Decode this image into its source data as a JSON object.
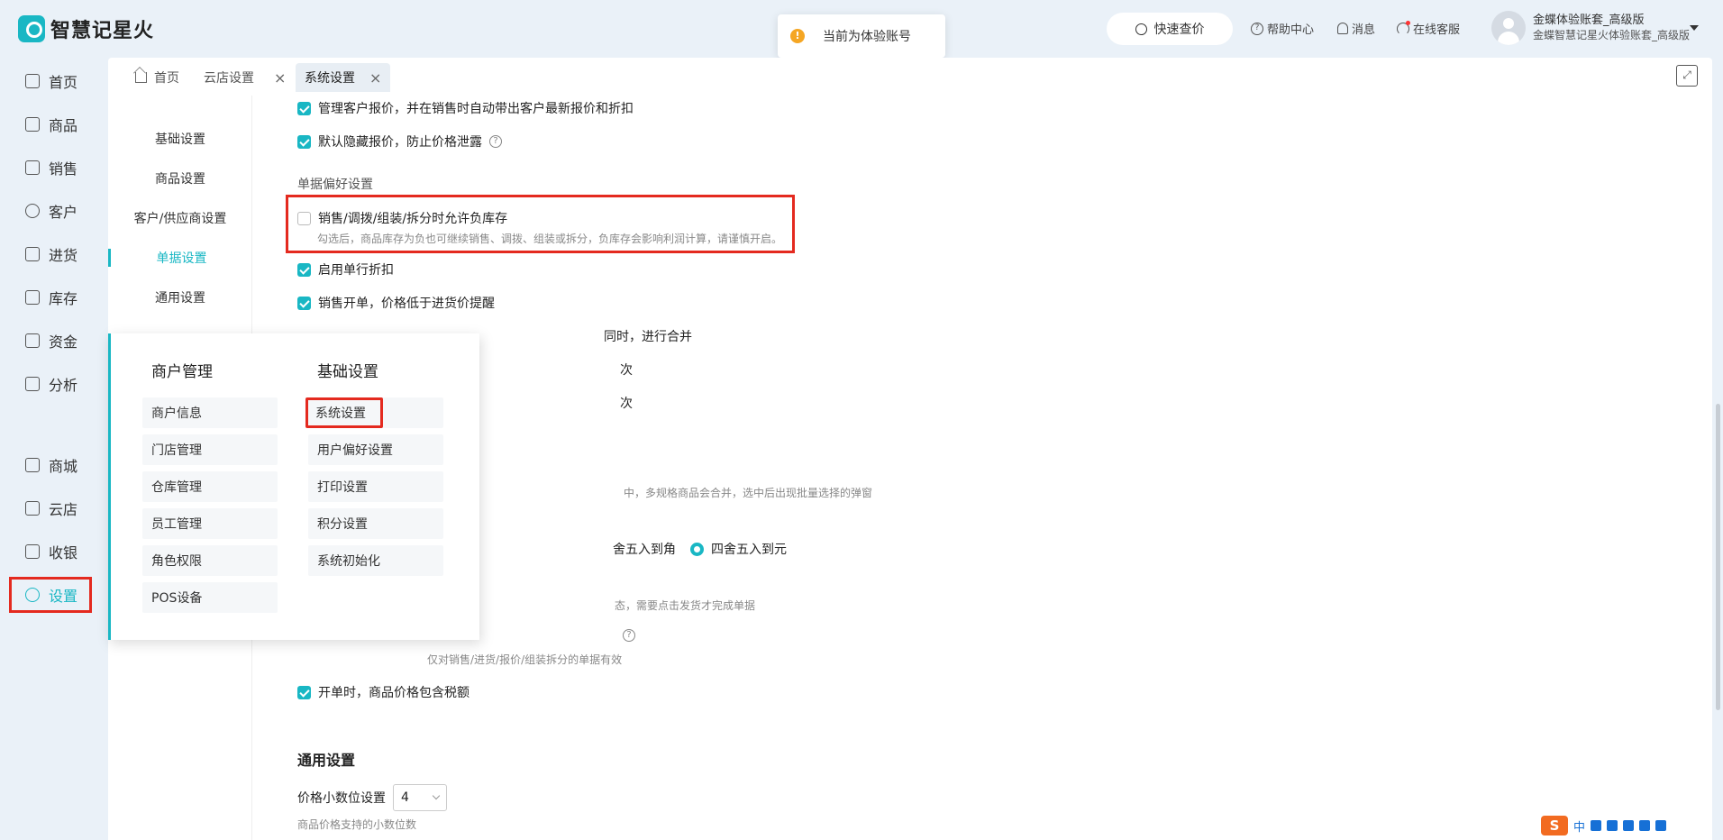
{
  "app": {
    "logo_text": "智慧记星火"
  },
  "toast": {
    "text": "当前为体验账号"
  },
  "topbar": {
    "quick_price": "快速查价",
    "help": "帮助中心",
    "messages": "消息",
    "online_service": "在线客服",
    "user_name": "金蝶体验账套_高级版",
    "user_sub": "金蝶智慧记星火体验账套_高级版"
  },
  "sidebar": {
    "items": [
      {
        "label": "首页"
      },
      {
        "label": "商品"
      },
      {
        "label": "销售"
      },
      {
        "label": "客户"
      },
      {
        "label": "进货"
      },
      {
        "label": "库存"
      },
      {
        "label": "资金"
      },
      {
        "label": "分析"
      },
      {
        "label": "商城"
      },
      {
        "label": "云店"
      },
      {
        "label": "收银"
      },
      {
        "label": "设置"
      }
    ]
  },
  "tabs": [
    {
      "label": "首页"
    },
    {
      "label": "云店设置"
    },
    {
      "label": "系统设置"
    }
  ],
  "subnav": {
    "items": [
      {
        "label": "基础设置"
      },
      {
        "label": "商品设置"
      },
      {
        "label": "客户/供应商设置"
      },
      {
        "label": "单据设置"
      },
      {
        "label": "通用设置"
      }
    ]
  },
  "content": {
    "opt_manage_price": "管理客户报价，并在销售时自动带出客户最新报价和折扣",
    "opt_hide_price": "默认隐藏报价，防止价格泄露",
    "doc_pref_label": "单据偏好设置",
    "opt_negative_stock": "销售/调拨/组装/拆分时允许负库存",
    "opt_negative_stock_hint": "勾选后，商品库存为负也可继续销售、调拨、组装或拆分，负库存会影响利润计算，请谨慎开启。",
    "opt_single_discount": "启用单行折扣",
    "opt_price_below_cost": "销售开单，价格低于进货价提醒",
    "opt_merge_partial": "同时，进行合并",
    "partial_tail_1": "次",
    "partial_tail_2": "次",
    "partial_hint_multi": "中，多规格商品会合并，选中后出现批量选择的弹窗",
    "partial_round_jiao": "舍五入到角",
    "opt_round_yuan": "四舍五入到元",
    "partial_hint_ship": "态，需要点击发货才完成单据",
    "partial_hint_docs": "仅对销售/进货/报价/组装拆分的单据有效",
    "opt_price_tax": "开单时，商品价格包含税额",
    "general_title": "通用设置",
    "decimal_label": "价格小数位设置",
    "decimal_value": "4",
    "decimal_hint": "商品价格支持的小数位数"
  },
  "flyout": {
    "col1_title": "商户管理",
    "col1_items": [
      {
        "label": "商户信息"
      },
      {
        "label": "门店管理"
      },
      {
        "label": "仓库管理"
      },
      {
        "label": "员工管理"
      },
      {
        "label": "角色权限"
      },
      {
        "label": "POS设备"
      }
    ],
    "col2_title": "基础设置",
    "col2_items": [
      {
        "label": "系统设置"
      },
      {
        "label": "用户偏好设置"
      },
      {
        "label": "打印设置"
      },
      {
        "label": "积分设置"
      },
      {
        "label": "系统初始化"
      }
    ]
  },
  "ime": {
    "lang": "中"
  },
  "colors": {
    "accent": "#19b7c4",
    "highlight": "#e42a1f",
    "background": "#eaf1f8"
  }
}
